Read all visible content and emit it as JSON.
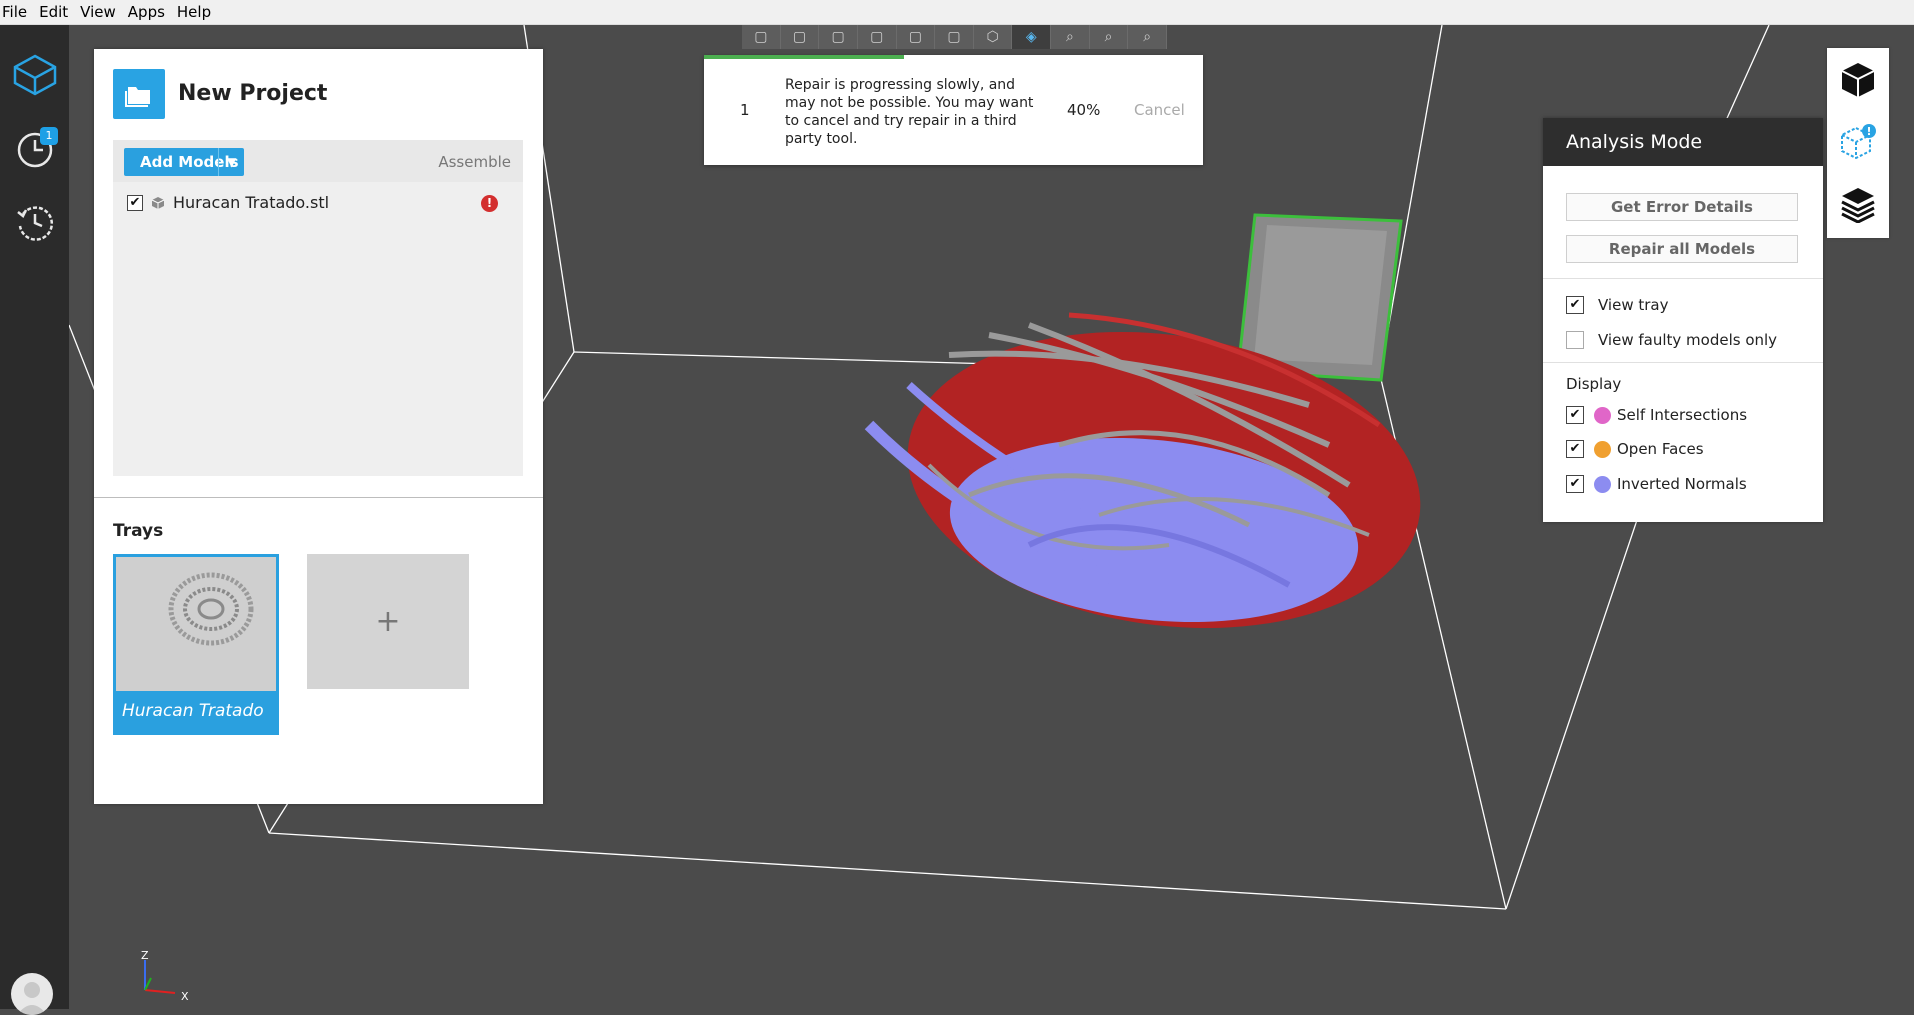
{
  "menu": [
    "File",
    "Edit",
    "View",
    "Apps",
    "Help"
  ],
  "rail": {
    "items": [
      {
        "name": "prepare-icon"
      },
      {
        "name": "print-queue-icon",
        "badge": "1"
      },
      {
        "name": "history-icon"
      }
    ]
  },
  "project": {
    "title": "New Project",
    "add_models_label": "Add Models",
    "assemble_label": "Assemble",
    "models": [
      {
        "name": "Huracan Tratado.stl",
        "checked": true,
        "error": true
      }
    ],
    "trays_title": "Trays",
    "trays": [
      {
        "label": "Huracan Tratado",
        "selected": true
      }
    ],
    "add_tray_label": "+"
  },
  "repair": {
    "count": "1",
    "message": "Repair is progressing slowly, and may not be possible. You may want to cancel and try repair in a third party tool.",
    "percent": "40%",
    "progress": 0.4,
    "cancel_label": "Cancel"
  },
  "analysis": {
    "title": "Analysis Mode",
    "get_error_details_label": "Get Error Details",
    "repair_all_label": "Repair all Models",
    "view_tray_label": "View tray",
    "view_tray_checked": true,
    "view_faulty_label": "View faulty models only",
    "view_faulty_checked": false,
    "display_title": "Display",
    "display_items": [
      {
        "label": "Self Intersections",
        "color": "#e066c8",
        "checked": true
      },
      {
        "label": "Open Faces",
        "color": "#f0a030",
        "checked": true
      },
      {
        "label": "Inverted Normals",
        "color": "#8c8cf0",
        "checked": true
      }
    ]
  },
  "axes": {
    "z": "Z",
    "x": "X"
  },
  "colors": {
    "accent": "#2aa0df",
    "error": "#d32f2f",
    "progress": "#4caf50"
  }
}
